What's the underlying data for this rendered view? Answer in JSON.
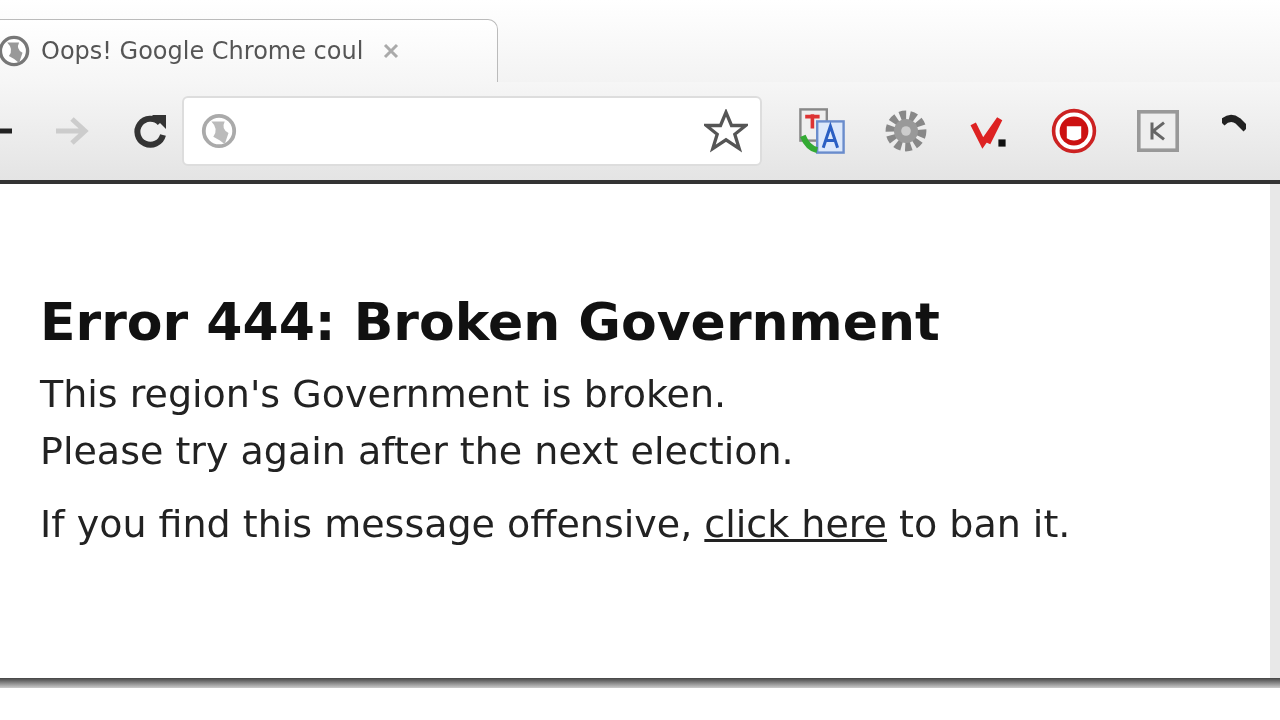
{
  "tab": {
    "title": "Oops! Google Chrome coul",
    "selected": true
  },
  "toolbar": {
    "back_disabled": false,
    "forward_disabled": true
  },
  "page": {
    "heading": "Error 444: Broken Government",
    "lines": [
      "This region's Government is broken.",
      "Please try again after the next election."
    ],
    "notice": {
      "before": "If you find this message offensive, ",
      "link": "click here",
      "after": " to ban it."
    }
  }
}
